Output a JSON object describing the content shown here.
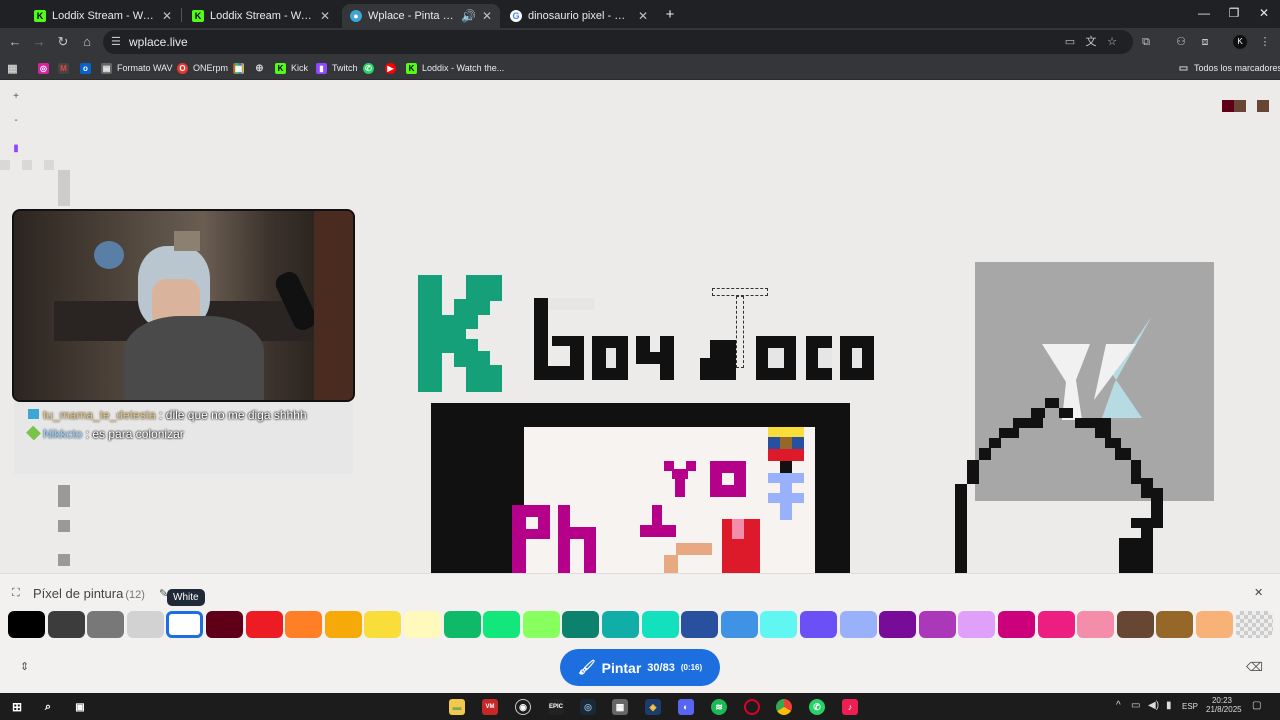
{
  "browser": {
    "tabs": [
      {
        "title": "Loddix Stream - Watch Live on",
        "active": false
      },
      {
        "title": "Loddix Stream - Watch Live on",
        "active": false
      },
      {
        "title": "Wplace - Pinta el mundo",
        "active": true
      },
      {
        "title": "dinosaurio pixel - Buscar con G",
        "active": false
      }
    ],
    "url": "wplace.live",
    "bookmarks": [
      {
        "label": "Formato WAV"
      },
      {
        "label": "ONErpm"
      },
      {
        "label": "Kick"
      },
      {
        "label": "Twitch"
      },
      {
        "label": "Loddix - Watch the..."
      }
    ],
    "all_bookmarks": "Todos los marcadores"
  },
  "canvas": {
    "zoom_in": "+",
    "zoom_out": "-",
    "chat": [
      {
        "user": "tu_mama_te_detesta",
        "sep": ":",
        "message": "dile que no me diga shhhh"
      },
      {
        "user": "Nikkcto",
        "sep": ":",
        "message": "es para colonizar"
      }
    ]
  },
  "palette_panel": {
    "title": "Píxel de pintura",
    "count": "(12)",
    "tooltip": "White",
    "colors": [
      "#000000",
      "#3c3c3c",
      "#787878",
      "#d2d2d2",
      "#ffffff",
      "#600018",
      "#ed1c24",
      "#ff7f27",
      "#f6aa09",
      "#f9dd3b",
      "#fffabc",
      "#0eb968",
      "#13e67b",
      "#87ff5e",
      "#0c816e",
      "#10aea6",
      "#13e1be",
      "#28509e",
      "#4093e4",
      "#60f7f2",
      "#6b50f6",
      "#99b1fb",
      "#780c99",
      "#aa38b9",
      "#e09ff9",
      "#cb007a",
      "#ec1f80",
      "#f38da9",
      "#684634",
      "#95682a",
      "#f8b277",
      "transparent"
    ],
    "selected_color": "#ffffff",
    "paint_label": "Pintar",
    "charges": "30/83",
    "timer": "(0:16)"
  },
  "taskbar": {
    "lang": "ESP",
    "time": "20:23",
    "date": "21/8/2025"
  }
}
